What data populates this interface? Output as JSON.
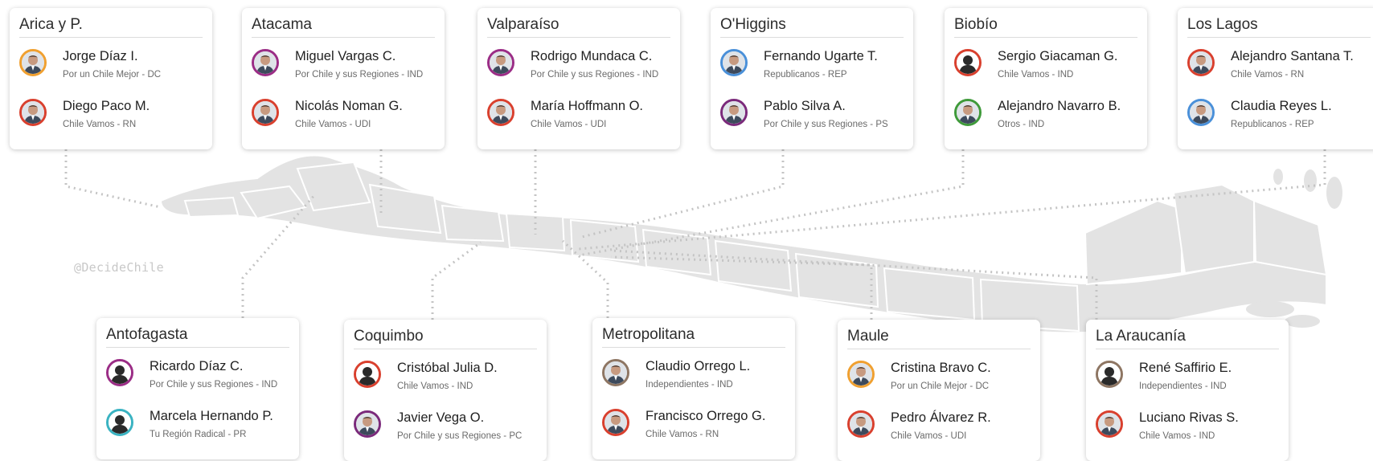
{
  "watermark": "@DecideChile",
  "colors": {
    "card_bg": "#ffffff",
    "connector": "#c4c4c4",
    "map_fill": "#e3e3e3",
    "party_colors": {
      "DC": "#f0a030",
      "RN": "#d9402e",
      "UDI": "#d9402e",
      "IND_left": "#9b2d86",
      "REP": "#4a90d9",
      "PS": "#7b2a7b",
      "IND_right": "#d9402e",
      "Otros": "#3f9a3a",
      "PR": "#3ab3c2",
      "PC": "#7b2a7b",
      "Independientes": "#8e7663"
    }
  },
  "regions": [
    {
      "id": "arica",
      "name": "Arica y P.",
      "candidates": [
        {
          "name": "Jorge Díaz I.",
          "party": "Por un Chile Mejor - DC",
          "ring": "#f0a030",
          "silhouette": false
        },
        {
          "name": "Diego Paco M.",
          "party": "Chile Vamos - RN",
          "ring": "#d9402e",
          "silhouette": false
        }
      ]
    },
    {
      "id": "atacama",
      "name": "Atacama",
      "candidates": [
        {
          "name": "Miguel Vargas C.",
          "party": "Por Chile y sus Regiones - IND",
          "ring": "#9b2d86",
          "silhouette": false
        },
        {
          "name": "Nicolás Noman G.",
          "party": "Chile Vamos - UDI",
          "ring": "#d9402e",
          "silhouette": false
        }
      ]
    },
    {
      "id": "valparaiso",
      "name": "Valparaíso",
      "candidates": [
        {
          "name": "Rodrigo Mundaca C.",
          "party": "Por Chile y sus Regiones - IND",
          "ring": "#9b2d86",
          "silhouette": false
        },
        {
          "name": "María Hoffmann O.",
          "party": "Chile Vamos - UDI",
          "ring": "#d9402e",
          "silhouette": false
        }
      ]
    },
    {
      "id": "ohiggins",
      "name": "O'Higgins",
      "candidates": [
        {
          "name": "Fernando Ugarte T.",
          "party": "Republicanos - REP",
          "ring": "#4a90d9",
          "silhouette": false
        },
        {
          "name": "Pablo Silva A.",
          "party": "Por Chile y sus Regiones - PS",
          "ring": "#7b2a7b",
          "silhouette": false
        }
      ]
    },
    {
      "id": "biobio",
      "name": "Biobío",
      "candidates": [
        {
          "name": "Sergio Giacaman G.",
          "party": "Chile Vamos - IND",
          "ring": "#d9402e",
          "silhouette": true
        },
        {
          "name": "Alejandro Navarro B.",
          "party": "Otros - IND",
          "ring": "#3f9a3a",
          "silhouette": false
        }
      ]
    },
    {
      "id": "loslagos",
      "name": "Los Lagos",
      "candidates": [
        {
          "name": "Alejandro Santana T.",
          "party": "Chile Vamos - RN",
          "ring": "#d9402e",
          "silhouette": false
        },
        {
          "name": "Claudia Reyes L.",
          "party": "Republicanos - REP",
          "ring": "#4a90d9",
          "silhouette": false
        }
      ]
    },
    {
      "id": "antofagasta",
      "name": "Antofagasta",
      "candidates": [
        {
          "name": "Ricardo Díaz C.",
          "party": "Por Chile y sus Regiones - IND",
          "ring": "#9b2d86",
          "silhouette": true
        },
        {
          "name": "Marcela Hernando P.",
          "party": "Tu Región Radical - PR",
          "ring": "#3ab3c2",
          "silhouette": true
        }
      ]
    },
    {
      "id": "coquimbo",
      "name": "Coquimbo",
      "candidates": [
        {
          "name": "Cristóbal Julia D.",
          "party": "Chile Vamos - IND",
          "ring": "#d9402e",
          "silhouette": true
        },
        {
          "name": "Javier Vega O.",
          "party": "Por Chile y sus Regiones - PC",
          "ring": "#7b2a7b",
          "silhouette": false
        }
      ]
    },
    {
      "id": "metropolitana",
      "name": "Metropolitana",
      "candidates": [
        {
          "name": "Claudio Orrego L.",
          "party": "Independientes - IND",
          "ring": "#8e7663",
          "silhouette": false
        },
        {
          "name": "Francisco Orrego G.",
          "party": "Chile Vamos - RN",
          "ring": "#d9402e",
          "silhouette": false
        }
      ]
    },
    {
      "id": "maule",
      "name": "Maule",
      "candidates": [
        {
          "name": "Cristina Bravo C.",
          "party": "Por un Chile Mejor - DC",
          "ring": "#f0a030",
          "silhouette": false
        },
        {
          "name": "Pedro Álvarez R.",
          "party": "Chile Vamos - UDI",
          "ring": "#d9402e",
          "silhouette": false
        }
      ]
    },
    {
      "id": "araucania",
      "name": "La Araucanía",
      "candidates": [
        {
          "name": "René Saffirio E.",
          "party": "Independientes - IND",
          "ring": "#8e7663",
          "silhouette": true
        },
        {
          "name": "Luciano Rivas S.",
          "party": "Chile Vamos - IND",
          "ring": "#d9402e",
          "silhouette": false
        }
      ]
    }
  ]
}
